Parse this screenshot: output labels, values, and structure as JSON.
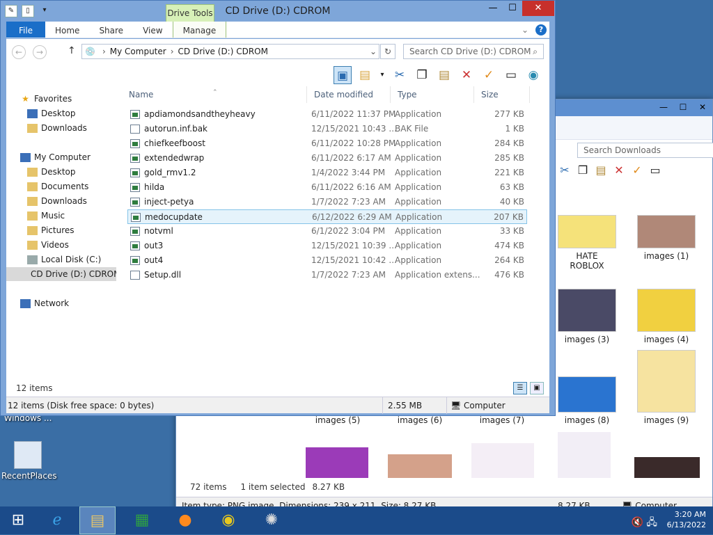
{
  "desktop": {
    "windows_label": "Windows ...",
    "recent_places": "RecentPlaces"
  },
  "bg_window": {
    "search_placeholder": "Search Downloads",
    "thumbs": [
      "HATE ROBLOX",
      "images (1)",
      "images (3)",
      "images (4)",
      "images (5)",
      "images (6)",
      "images (7)",
      "images (8)",
      "images (9)"
    ],
    "status_count": "72 items",
    "status_selected": "1 item selected",
    "status_size": "8.27 KB",
    "detail_text": "Item type: PNG image, Dimensions: 239 x 211, Size: 8.27 KB",
    "detail_size": "8.27 KB",
    "detail_location": "Computer"
  },
  "window": {
    "title": "CD Drive (D:) CDROM",
    "contextual_tab": "Drive Tools",
    "tabs": [
      "File",
      "Home",
      "Share",
      "View",
      "Manage"
    ],
    "address": {
      "segments": [
        "My Computer",
        "CD Drive (D:) CDROM"
      ],
      "search_placeholder": "Search CD Drive (D:) CDROM"
    },
    "nav": {
      "favorites": "Favorites",
      "fav_items": [
        "Desktop",
        "Downloads"
      ],
      "computer": "My Computer",
      "computer_items": [
        "Desktop",
        "Documents",
        "Downloads",
        "Music",
        "Pictures",
        "Videos",
        "Local Disk (C:)",
        "CD Drive (D:) CDROM"
      ],
      "network": "Network"
    },
    "columns": [
      "Name",
      "Date modified",
      "Type",
      "Size"
    ],
    "files": [
      {
        "name": "apdiamondsandtheyheavy",
        "date": "6/11/2022 11:37 PM",
        "type": "Application",
        "size": "277 KB"
      },
      {
        "name": "autorun.inf.bak",
        "date": "12/15/2021 10:43 ...",
        "type": "BAK File",
        "size": "1 KB"
      },
      {
        "name": "chiefkeefboost",
        "date": "6/11/2022 10:28 PM",
        "type": "Application",
        "size": "284 KB"
      },
      {
        "name": "extendedwrap",
        "date": "6/11/2022 6:17 AM",
        "type": "Application",
        "size": "285 KB"
      },
      {
        "name": "gold_rmv1.2",
        "date": "1/4/2022 3:44 PM",
        "type": "Application",
        "size": "221 KB"
      },
      {
        "name": "hilda",
        "date": "6/11/2022 6:16 AM",
        "type": "Application",
        "size": "63 KB"
      },
      {
        "name": "inject-petya",
        "date": "1/7/2022 7:23 AM",
        "type": "Application",
        "size": "40 KB"
      },
      {
        "name": "medocupdate",
        "date": "6/12/2022 6:29 AM",
        "type": "Application",
        "size": "207 KB"
      },
      {
        "name": "notvml",
        "date": "6/1/2022 3:04 PM",
        "type": "Application",
        "size": "33 KB"
      },
      {
        "name": "out3",
        "date": "12/15/2021 10:39 ...",
        "type": "Application",
        "size": "474 KB"
      },
      {
        "name": "out4",
        "date": "12/15/2021 10:42 ...",
        "type": "Application",
        "size": "264 KB"
      },
      {
        "name": "Setup.dll",
        "date": "1/7/2022 7:23 AM",
        "type": "Application extens...",
        "size": "476 KB"
      }
    ],
    "item_count": "12 items",
    "status_left": "12 items (Disk free space: 0 bytes)",
    "status_size": "2.55 MB",
    "status_location": "Computer"
  },
  "taskbar": {
    "time": "3:20 AM",
    "date": "6/13/2022"
  },
  "colors": {
    "accent": "#1a6ec8",
    "selection": "#e5f3fb",
    "taskbar": "#1b4b8a"
  }
}
